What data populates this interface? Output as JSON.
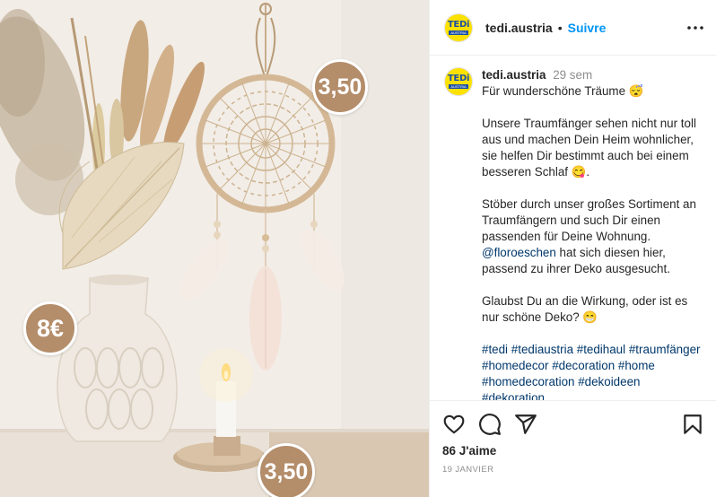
{
  "photo": {
    "alt_subject": "",
    "prices": [
      "3,50",
      "8€",
      "3,50"
    ]
  },
  "brand": {
    "logo_text": "TEDi",
    "logo_subtext": "AUSTRIA",
    "logo_color": "#fde200",
    "logo_text_color": "#1b4fa3"
  },
  "header": {
    "username": "tedi.austria",
    "separator": "•",
    "follow_label": "Suivre",
    "more_icon": "more-options-icon"
  },
  "caption": {
    "username": "tedi.austria",
    "time": "29 sem",
    "line1": "Für wunderschöne Träume 😴",
    "para2": "Unsere Traumfänger sehen nicht nur toll aus und machen Dein Heim wohnlicher, sie helfen Dir bestimmt auch bei einem besseren Schlaf 😋.",
    "para3_a": "Stöber durch unser großes Sortiment an Traumfängern und such Dir einen passenden für Deine Wohnung.",
    "para3_mention": "@floroeschen",
    "para3_b": " hat sich diesen hier, passend zu ihrer Deko ausgesucht.",
    "para4": "Glaubst Du an die Wirkung, oder ist es nur schöne Deko? 😁",
    "hashtags": [
      "#tedi",
      "#tediaustria",
      "#tedihaul",
      "#traumfänger",
      "#homedecor",
      "#decoration",
      "#home",
      "#homedecoration",
      "#dekoideen",
      "#dekoration"
    ]
  },
  "actions": {
    "icons": [
      "heart-icon",
      "comment-icon",
      "share-icon",
      "bookmark-icon"
    ],
    "likes": "86 J'aime",
    "date": "19 JANVIER"
  },
  "colors": {
    "link": "#00376b",
    "follow": "#0095f6",
    "muted": "#8e8e8e",
    "price_badge": "#b48d6a"
  }
}
